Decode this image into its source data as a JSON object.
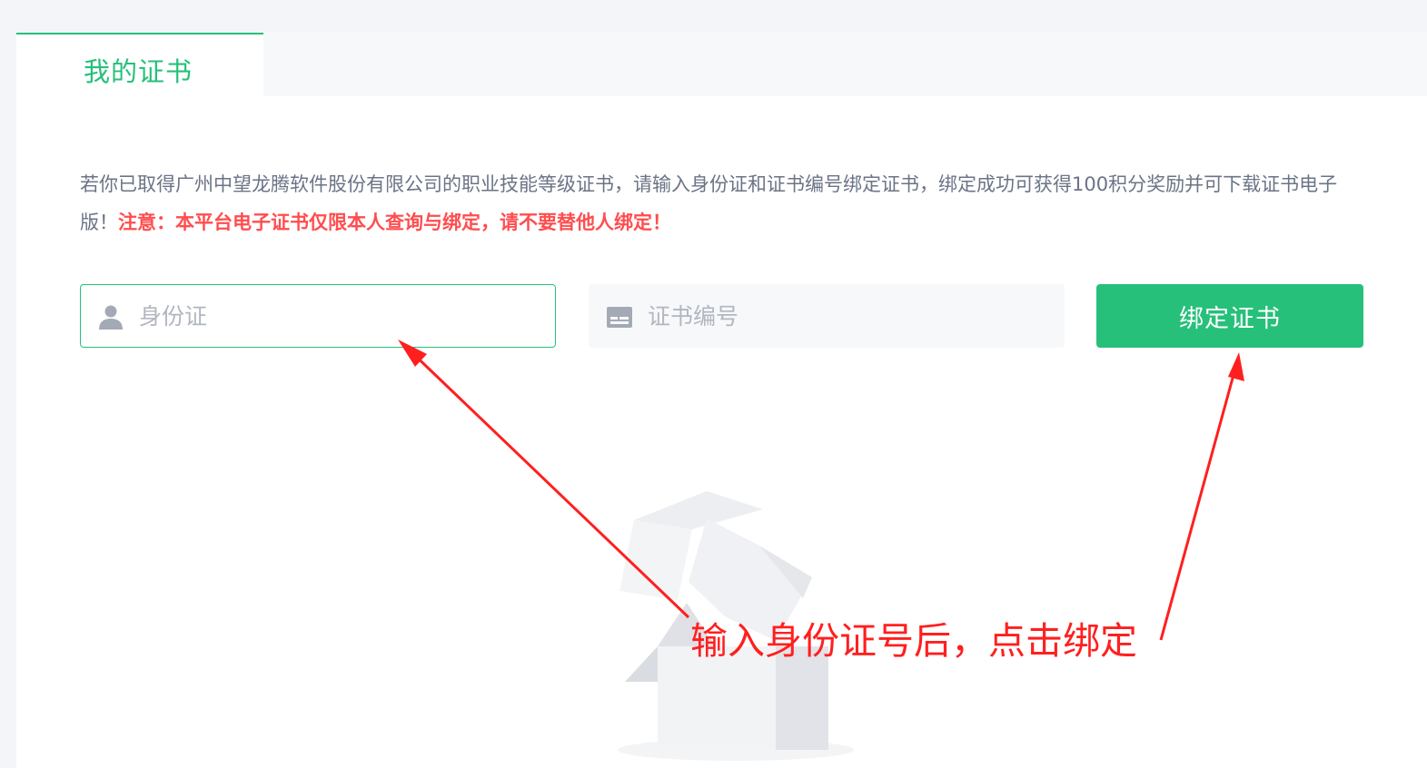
{
  "tabs": [
    {
      "label": "我的证书",
      "active": true
    }
  ],
  "notice": {
    "text": "若你已取得广州中望龙腾软件股份有限公司的职业技能等级证书，请输入身份证和证书编号绑定证书，绑定成功可获得100积分奖励并可下载证书电子版！",
    "warning": "注意：本平台电子证书仅限本人查询与绑定，请不要替他人绑定！"
  },
  "form": {
    "id_placeholder": "身份证",
    "id_value": "",
    "cert_placeholder": "证书编号",
    "cert_value": "",
    "bind_label": "绑定证书"
  },
  "annotation": {
    "text": "输入身份证号后，点击绑定"
  },
  "colors": {
    "accent": "#26c07a",
    "warning": "#ff4d4f",
    "annotation": "#ff1f1f"
  },
  "icons": {
    "id_field": "person-icon",
    "cert_field": "card-icon",
    "empty_state": "empty-box-illustration"
  }
}
